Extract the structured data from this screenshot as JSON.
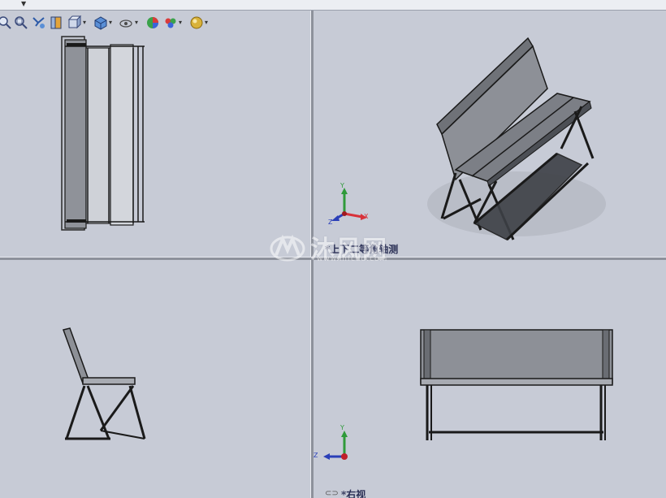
{
  "toolbar": {
    "icons": [
      "zoom-to-fit-icon",
      "zoom-area-icon",
      "previous-view-icon",
      "section-view-icon",
      "view-orientation-icon",
      "display-style-icon",
      "hide-show-items-icon",
      "edit-appearance-icon",
      "apply-scene-icon",
      "view-settings-icon"
    ]
  },
  "viewports": {
    "top_left": {
      "label": ""
    },
    "top_right": {
      "label": "*上下二等角轴测"
    },
    "bottom_left": {
      "label": ""
    },
    "bottom_right": {
      "label": "*右视"
    }
  },
  "triad": {
    "x_label": "X",
    "y_label": "Y",
    "z_label": "Z"
  },
  "watermark": {
    "text": "沐风网",
    "sub": "www.mfcad.com"
  },
  "colors": {
    "background": "#c7cbd6",
    "x_axis": "#d8323a",
    "y_axis": "#2f9a3a",
    "z_axis": "#2a3fb8"
  }
}
